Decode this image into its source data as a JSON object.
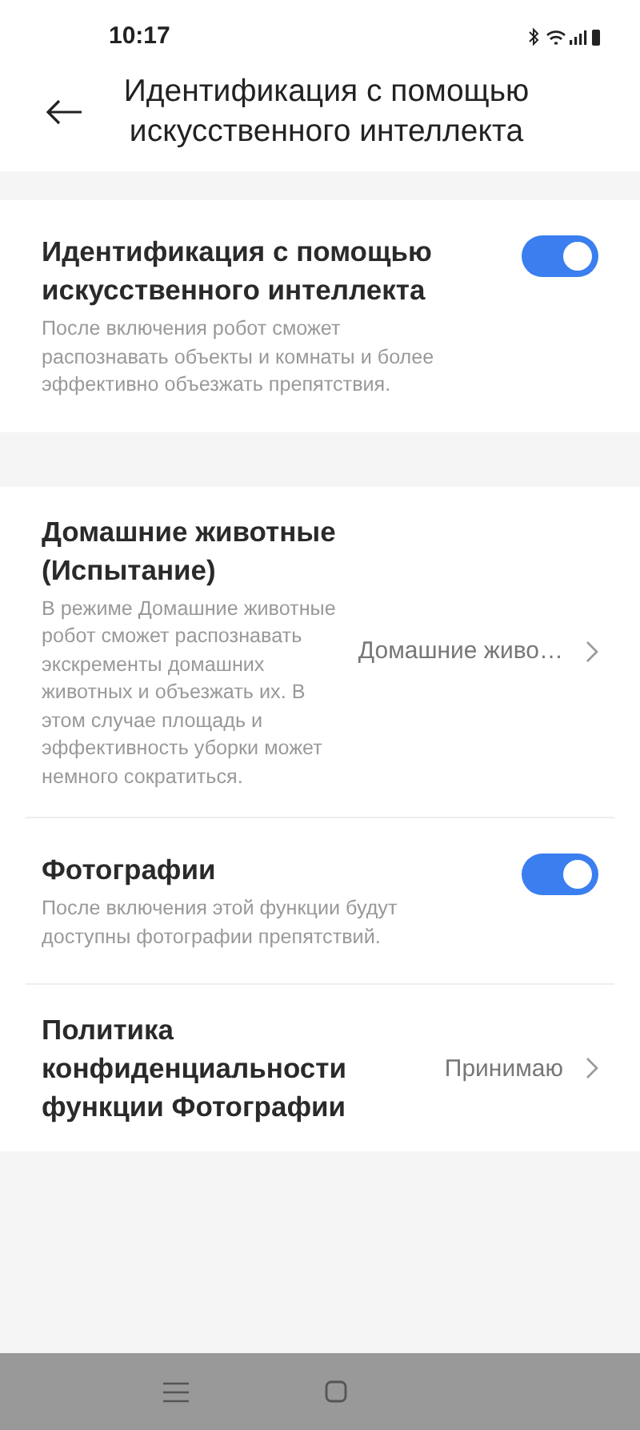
{
  "status_bar": {
    "time": "10:17"
  },
  "header": {
    "title": "Идентификация с помощью искусственного интеллекта"
  },
  "sections": [
    {
      "items": [
        {
          "kind": "toggle",
          "title": "Идентификация с помощью искусственного интеллекта",
          "description": "После включения робот сможет распознавать объекты и комнаты и более эффективно объезжать препятствия.",
          "on": true
        }
      ]
    },
    {
      "items": [
        {
          "kind": "link",
          "title": "Домашние животные (Испытание)",
          "description": "В режиме Домашние животные робот сможет распознавать экскременты домашних животных и объезжать их. В этом случае площадь и эффективность уборки может немного сократиться.",
          "value": "Домашние живо…"
        },
        {
          "kind": "toggle",
          "title": "Фотографии",
          "description": "После включения этой функции будут доступны фотографии препятствий.",
          "on": true
        },
        {
          "kind": "link",
          "title": "Политика конфиденциальности функции Фотографии",
          "value": "Принимаю"
        }
      ]
    }
  ]
}
